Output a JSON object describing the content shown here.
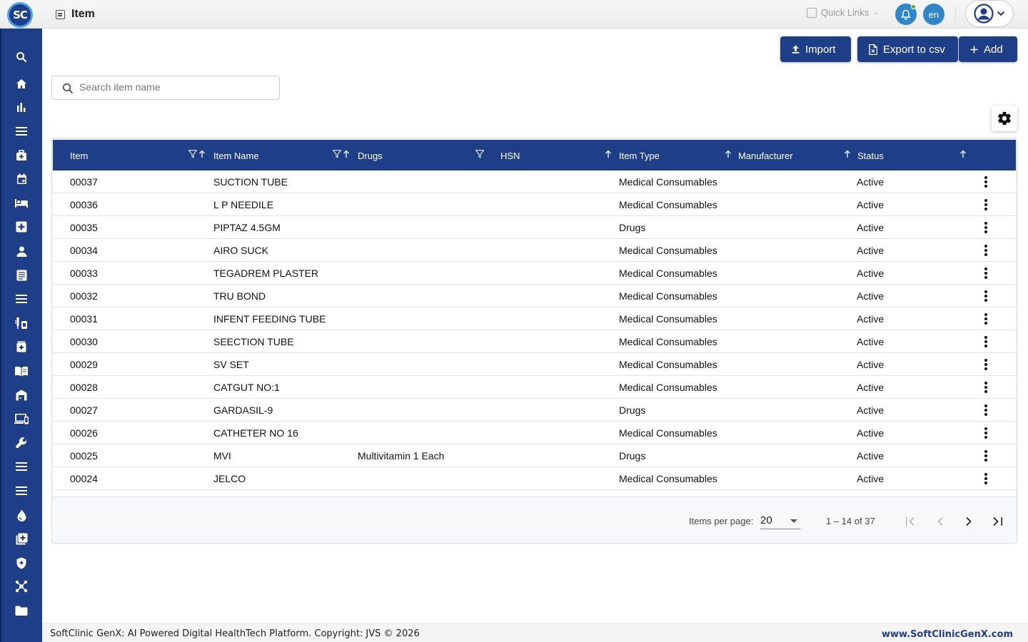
{
  "app": {
    "logo_text": "SC",
    "page_title": "Item"
  },
  "topbar": {
    "quick_links": "Quick Links",
    "lang": "en"
  },
  "sidebar": {
    "items": [
      "search-icon",
      "home-icon",
      "chart-icon",
      "menu-icon",
      "medical-bag-icon",
      "calendar-icon",
      "bed-icon",
      "medical-plus-icon",
      "person-icon",
      "document-icon",
      "list-icon",
      "lab-icon",
      "pharmacy-icon",
      "book-icon",
      "store-icon",
      "devices-icon",
      "wrench-icon",
      "menu-icon",
      "menu-icon",
      "blood-drop-icon",
      "add-record-icon",
      "shield-icon",
      "hub-icon",
      "folder-icon"
    ]
  },
  "actions": {
    "import": "Import",
    "export": "Export to csv",
    "add": "Add"
  },
  "search": {
    "placeholder": "Search item name"
  },
  "table": {
    "headers": {
      "item": "Item",
      "item_name": "Item Name",
      "drugs": "Drugs",
      "hsn": "HSN",
      "item_type": "Item Type",
      "manufacturer": "Manufacturer",
      "status": "Status"
    },
    "rows": [
      {
        "item": "00037",
        "name": "SUCTION TUBE",
        "drugs": "",
        "type": "Medical Consumables",
        "status": "Active"
      },
      {
        "item": "00036",
        "name": "L P NEEDILE",
        "drugs": "",
        "type": "Medical Consumables",
        "status": "Active"
      },
      {
        "item": "00035",
        "name": "PIPTAZ 4.5GM",
        "drugs": "",
        "type": "Drugs",
        "status": "Active"
      },
      {
        "item": "00034",
        "name": "AIRO SUCK",
        "drugs": "",
        "type": "Medical Consumables",
        "status": "Active"
      },
      {
        "item": "00033",
        "name": "TEGADREM PLASTER",
        "drugs": "",
        "type": "Medical Consumables",
        "status": "Active"
      },
      {
        "item": "00032",
        "name": "TRU BOND",
        "drugs": "",
        "type": "Medical Consumables",
        "status": "Active"
      },
      {
        "item": "00031",
        "name": "INFENT FEEDING TUBE",
        "drugs": "",
        "type": "Medical Consumables",
        "status": "Active"
      },
      {
        "item": "00030",
        "name": "SEECTION TUBE",
        "drugs": "",
        "type": "Medical Consumables",
        "status": "Active"
      },
      {
        "item": "00029",
        "name": "SV SET",
        "drugs": "",
        "type": "Medical Consumables",
        "status": "Active"
      },
      {
        "item": "00028",
        "name": "CATGUT NO:1",
        "drugs": "",
        "type": "Medical Consumables",
        "status": "Active"
      },
      {
        "item": "00027",
        "name": "GARDASIL-9",
        "drugs": "",
        "type": "Drugs",
        "status": "Active"
      },
      {
        "item": "00026",
        "name": "CATHETER NO 16",
        "drugs": "",
        "type": "Medical Consumables",
        "status": "Active"
      },
      {
        "item": "00025",
        "name": "MVI",
        "drugs": "Multivitamin 1 Each",
        "type": "Drugs",
        "status": "Active"
      },
      {
        "item": "00024",
        "name": "JELCO",
        "drugs": "",
        "type": "Medical Consumables",
        "status": "Active"
      }
    ]
  },
  "paginator": {
    "label": "Items per page:",
    "page_size": "20",
    "range": "1 – 14 of 37"
  },
  "footer": {
    "left": "SoftClinic GenX: AI Powered Digital HealthTech Platform. Copyright: JVS © 2026",
    "right": "www.SoftClinicGenX.com"
  }
}
